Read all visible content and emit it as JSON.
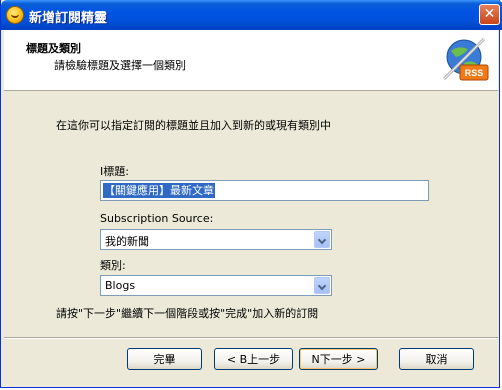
{
  "window": {
    "title": "新增訂閱精靈",
    "close_label": "✕"
  },
  "header": {
    "title": "標題及類別",
    "subtitle": "請檢驗標題及選擇一個類別",
    "badge": "RSS"
  },
  "main": {
    "intro": "在這你可以指定訂閱的標題並且加入到新的或現有類別中",
    "title_label": "I標題:",
    "title_value": "【關鍵應用】最新文章",
    "source_label": "Subscription Source:",
    "source_value": "我的新聞",
    "category_label": "類別:",
    "category_value": "Blogs",
    "hint": "請按\"下一步\"繼續下一個階段或按\"完成\"加入新的訂閱"
  },
  "buttons": {
    "finish": "完畢",
    "back": "< B上一步",
    "next": "N下一步 >",
    "cancel": "取消"
  },
  "colors": {
    "titlebar": "#0054e3",
    "dialog_bg": "#ece9d8",
    "selection": "#316ac5",
    "icons": [
      "smiley-icon",
      "rss-feed-icon",
      "dropdown-arrow-icon",
      "close-icon"
    ]
  }
}
